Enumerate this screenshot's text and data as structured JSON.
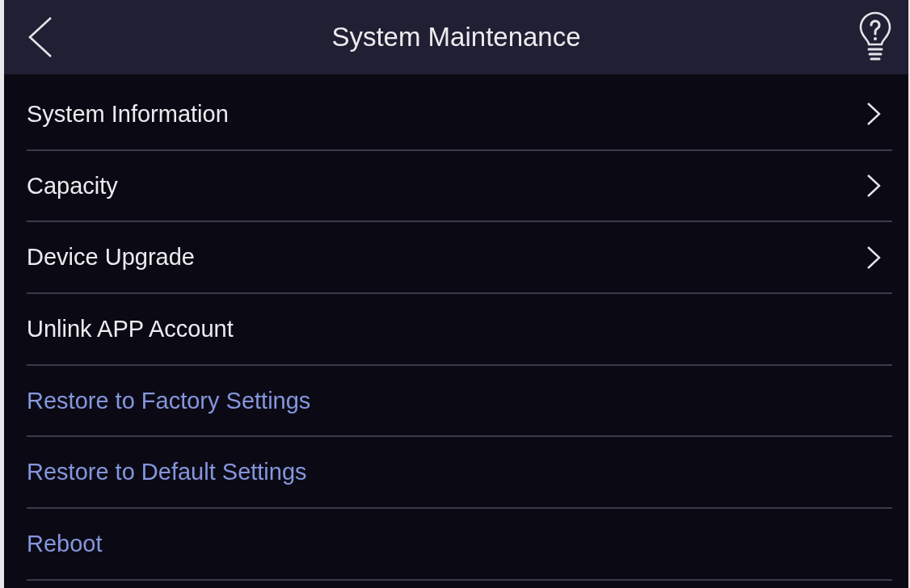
{
  "header": {
    "title": "System Maintenance"
  },
  "menu_items": [
    {
      "label": "System Information",
      "kind": "submenu"
    },
    {
      "label": "Capacity",
      "kind": "submenu"
    },
    {
      "label": "Device Upgrade",
      "kind": "submenu"
    },
    {
      "label": "Unlink APP Account",
      "kind": "plain"
    },
    {
      "label": "Restore to Factory Settings",
      "kind": "accent"
    },
    {
      "label": "Restore to Default Settings",
      "kind": "accent"
    },
    {
      "label": "Reboot",
      "kind": "accent"
    }
  ]
}
